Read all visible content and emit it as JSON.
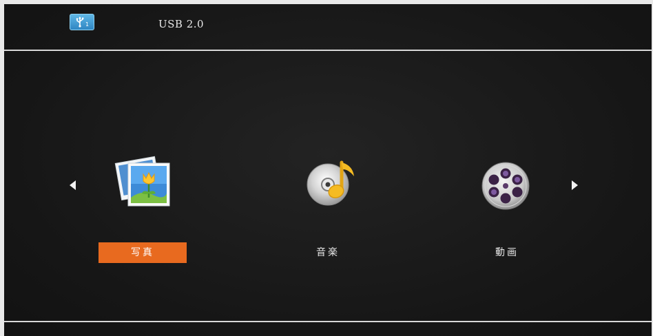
{
  "header": {
    "usb_badge_text": "1",
    "title": "USB 2.0"
  },
  "menu": {
    "items": [
      {
        "id": "photo",
        "label": "写真",
        "icon": "photo-icon",
        "selected": true
      },
      {
        "id": "music",
        "label": "音楽",
        "icon": "music-icon",
        "selected": false
      },
      {
        "id": "video",
        "label": "動画",
        "icon": "film-reel-icon",
        "selected": false
      }
    ]
  },
  "colors": {
    "accent": "#e86a1f",
    "background": "#171717",
    "text": "#e6e6e6",
    "divider": "#d9d9d9",
    "usb_badge": "#3a98d2"
  }
}
